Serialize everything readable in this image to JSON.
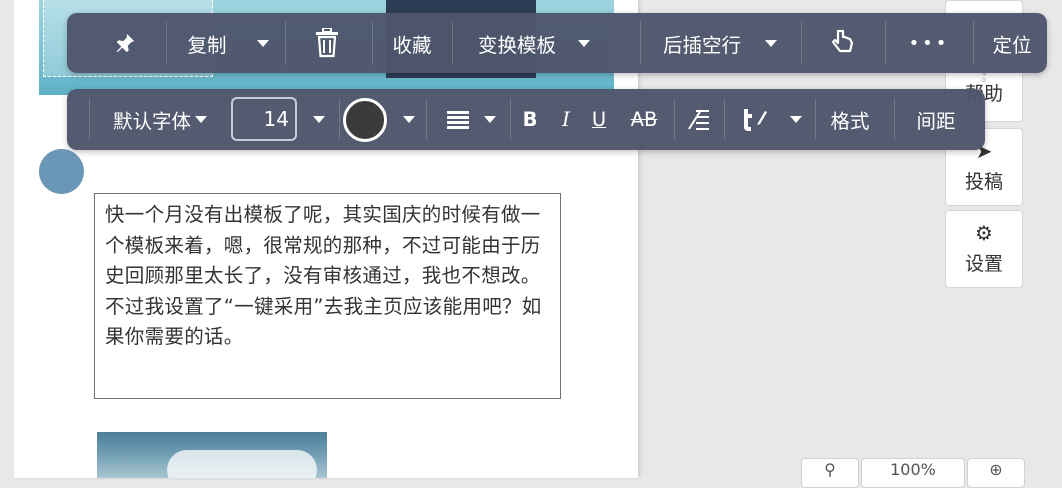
{
  "toolbar_top": {
    "pin_icon": "pin-icon",
    "copy_label": "复制",
    "delete_icon": "trash-icon",
    "favorite_label": "收藏",
    "switch_template_label": "变换模板",
    "insert_blank_line_label": "后插空行",
    "pointer_icon": "hand-pointer-icon",
    "more_label": "•••",
    "locate_label": "定位"
  },
  "toolbar_format": {
    "font_label": "默认字体",
    "font_size": "14",
    "text_color": "#3b3b3b",
    "bold_label": "B",
    "italic_label": "I",
    "underline_label": "U",
    "strike_label": "AB",
    "style_label": "格式",
    "spacing_label": "间距"
  },
  "content": {
    "paragraph": "快一个月没有出模板了呢，其实国庆的时候有做一个模板来着，嗯，很常规的那种，不过可能由于历史回顾那里太长了，没有审核通过，我也不想改。不过我设置了“一键采用”去我主页应该能用吧？如果你需要的话。"
  },
  "side_panel": {
    "help_label": "帮助",
    "post_label": "投稿",
    "settings_label": "设置"
  },
  "zoom": {
    "value": "100%"
  }
}
